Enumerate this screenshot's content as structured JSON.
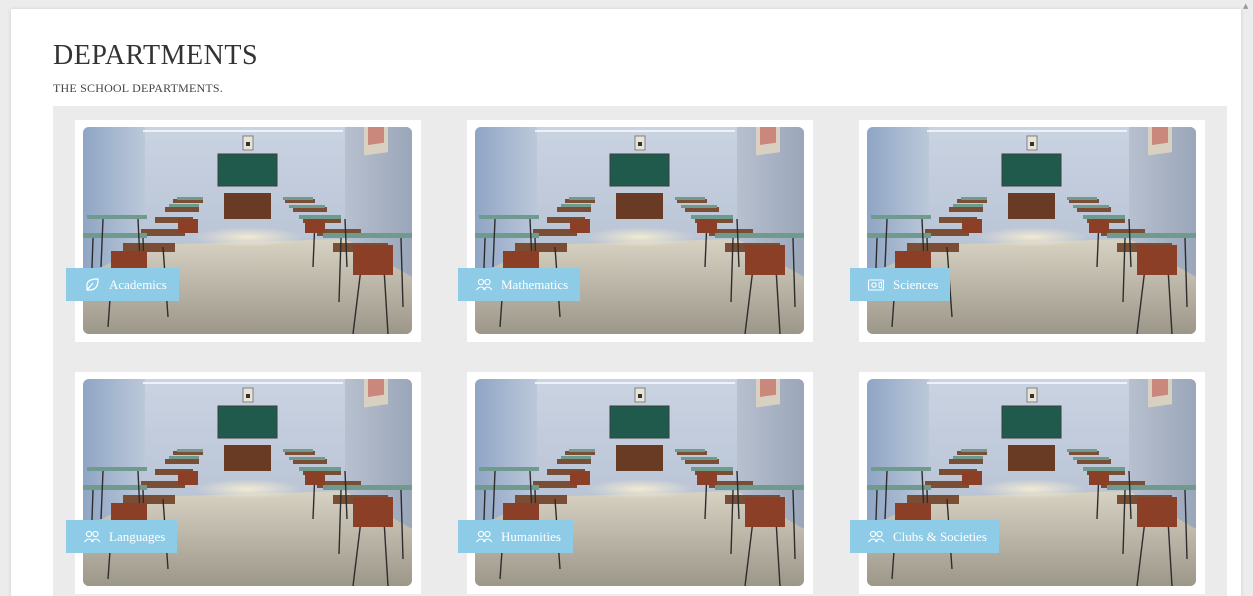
{
  "header": {
    "title": "DEPARTMENTS",
    "subtitle": "THE SCHOOL DEPARTMENTS."
  },
  "departments": [
    {
      "label": "Academics",
      "icon": "leaf-tag-icon"
    },
    {
      "label": "Mathematics",
      "icon": "users-icon"
    },
    {
      "label": "Sciences",
      "icon": "video-camera-icon"
    },
    {
      "label": "Languages",
      "icon": "users-icon"
    },
    {
      "label": "Humanities",
      "icon": "users-icon"
    },
    {
      "label": "Clubs & Societies",
      "icon": "users-icon"
    }
  ],
  "colors": {
    "tag_background": "#8ecbe6",
    "panel_background": "#ebebeb"
  }
}
